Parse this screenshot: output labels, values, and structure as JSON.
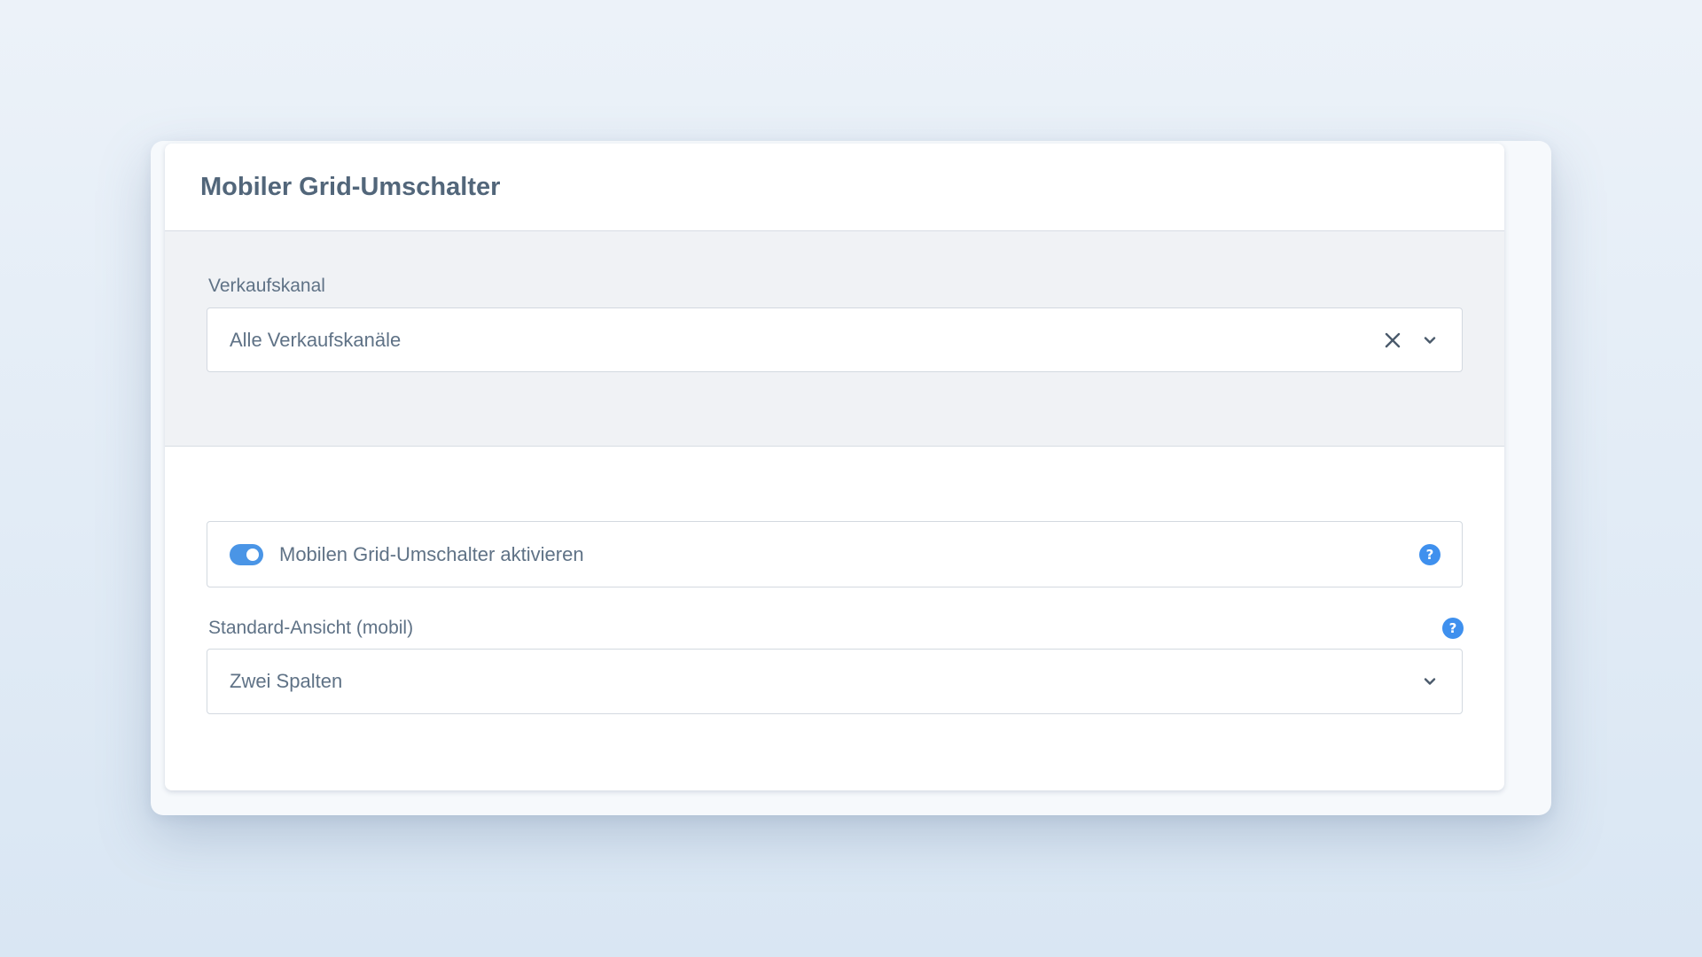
{
  "card": {
    "title": "Mobiler Grid-Umschalter"
  },
  "sales_channel": {
    "label": "Verkaufskanal",
    "value": "Alle Verkaufskanäle"
  },
  "grid_toggle": {
    "label": "Mobilen Grid-Umschalter aktivieren",
    "enabled": true,
    "help_glyph": "?"
  },
  "default_view": {
    "label": "Standard-Ansicht (mobil)",
    "value": "Zwei Spalten",
    "help_glyph": "?"
  },
  "colors": {
    "accent": "#4a95e6",
    "help": "#3f90ee",
    "text": "#5f7286",
    "title": "#52667a"
  },
  "icons": {
    "clear": "close-icon",
    "dropdown": "chevron-down-icon",
    "help": "question-circle-icon"
  }
}
